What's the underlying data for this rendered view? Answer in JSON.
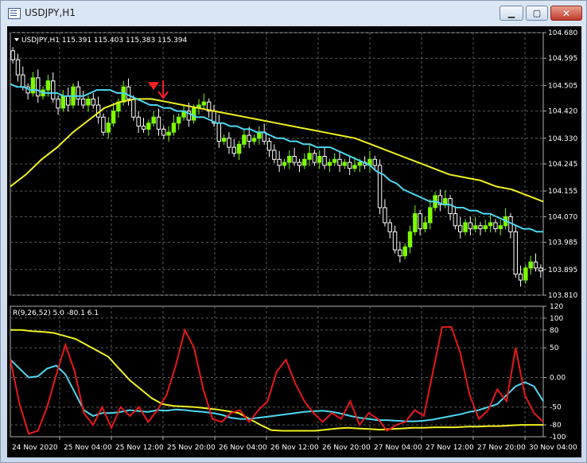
{
  "window": {
    "title": "USDJPY,H1",
    "buttons": {
      "minimize": "▁",
      "maximize": "▢",
      "close": "✕"
    }
  },
  "colors": {
    "background": "#000000",
    "grid": "#5a5a5a",
    "bull_candle": "#7cfc00",
    "bear_candle": "#ffffff",
    "ma_fast": "#4dd8f0",
    "ma_slow": "#f0f020",
    "indicator_line": "#e81818",
    "signal_arrow": "#ff2020",
    "text": "#ffffff"
  },
  "chart_data": [
    {
      "type": "candlestick",
      "header": "USDJPY,H1  115.391 115.403 115.383 115.394",
      "ylim": [
        103.81,
        104.68
      ],
      "y_ticks": [
        "104.680",
        "104.595",
        "104.505",
        "104.420",
        "104.330",
        "104.245",
        "104.155",
        "104.070",
        "103.985",
        "103.895",
        "103.810"
      ],
      "closes": [
        104.59,
        104.54,
        104.5,
        104.48,
        104.53,
        104.47,
        104.49,
        104.52,
        104.46,
        104.43,
        104.47,
        104.44,
        104.5,
        104.46,
        104.44,
        104.46,
        104.44,
        104.4,
        104.35,
        104.38,
        104.42,
        104.45,
        104.5,
        104.46,
        104.4,
        104.37,
        104.36,
        104.38,
        104.4,
        104.36,
        104.34,
        104.35,
        104.38,
        104.4,
        104.42,
        104.39,
        104.43,
        104.44,
        104.45,
        104.42,
        104.38,
        104.32,
        104.33,
        104.3,
        104.28,
        104.31,
        104.34,
        104.32,
        104.33,
        104.35,
        104.32,
        104.29,
        104.26,
        104.24,
        104.25,
        104.27,
        104.25,
        104.24,
        104.26,
        104.28,
        104.25,
        104.27,
        104.24,
        104.25,
        104.26,
        104.24,
        104.25,
        104.23,
        104.24,
        104.25,
        104.24,
        104.26,
        104.24,
        104.1,
        104.05,
        104.02,
        103.96,
        103.94,
        103.97,
        104.02,
        104.08,
        104.03,
        104.05,
        104.1,
        104.14,
        104.11,
        104.13,
        104.08,
        104.04,
        104.02,
        104.05,
        104.03,
        104.04,
        104.03,
        104.04,
        104.05,
        104.03,
        104.04,
        104.07,
        104.02,
        103.88,
        103.86,
        103.9,
        103.92,
        103.9,
        103.89
      ],
      "ma_fast": [
        104.51,
        104.5,
        104.5,
        104.49,
        104.49,
        104.48,
        104.48,
        104.48,
        104.47,
        104.47,
        104.47,
        104.47,
        104.48,
        104.49,
        104.49,
        104.49,
        104.48,
        104.48,
        104.47,
        104.46,
        104.45,
        104.44,
        104.44,
        104.43,
        104.43,
        104.42,
        104.42,
        104.41,
        104.4,
        104.4,
        104.39,
        104.38,
        104.38,
        104.37,
        104.37,
        104.36,
        104.36,
        104.35,
        104.35,
        104.34,
        104.33,
        104.33,
        104.32,
        104.32,
        104.31,
        104.31,
        104.3,
        104.3,
        104.3,
        104.29,
        104.28,
        104.27,
        104.26,
        104.25,
        104.24,
        104.22,
        104.21,
        104.19,
        104.18,
        104.16,
        104.15,
        104.14,
        104.13,
        104.12,
        104.12,
        104.11,
        104.11,
        104.1,
        104.1,
        104.09,
        104.09,
        104.08,
        104.08,
        104.07,
        104.06,
        104.05,
        104.04,
        104.03,
        104.03,
        104.02,
        104.02
      ],
      "ma_slow": [
        104.17,
        104.21,
        104.26,
        104.3,
        104.35,
        104.39,
        104.43,
        104.45,
        104.46,
        104.46,
        104.45,
        104.44,
        104.43,
        104.42,
        104.41,
        104.4,
        104.39,
        104.38,
        104.37,
        104.36,
        104.35,
        104.34,
        104.33,
        104.31,
        104.29,
        104.27,
        104.25,
        104.23,
        104.21,
        104.2,
        104.19,
        104.17,
        104.16,
        104.14,
        104.12
      ],
      "signal_arrow_at_bar": 28
    },
    {
      "type": "line",
      "header": "R(9,26,52) 5.0 -80.1 6.1",
      "ylim": [
        -100,
        120
      ],
      "y_ticks": [
        "120",
        "100",
        "80",
        "50",
        "0.00",
        "-50",
        "-80",
        "-100"
      ],
      "x_tick_labels": [
        "24 Nov 2020",
        "25 Nov 04:00",
        "25 Nov 12:00",
        "25 Nov 20:00",
        "26 Nov 04:00",
        "26 Nov 12:00",
        "26 Nov 20:00",
        "27 Nov 04:00",
        "27 Nov 12:00",
        "27 Nov 20:00",
        "30 Nov 04:00"
      ],
      "series": [
        {
          "color": "#e81818",
          "values": [
            30,
            -45,
            -95,
            -90,
            -50,
            5,
            55,
            10,
            -60,
            -80,
            -50,
            -85,
            -50,
            -65,
            -50,
            -75,
            -55,
            -30,
            20,
            80,
            50,
            -20,
            -70,
            -75,
            -60,
            -55,
            -75,
            -55,
            -40,
            10,
            30,
            -10,
            -40,
            -60,
            -75,
            -60,
            -70,
            -40,
            -80,
            -60,
            -70,
            -90,
            -80,
            -75,
            -55,
            -65,
            10,
            85,
            85,
            40,
            -30,
            -70,
            -55,
            -20,
            -40,
            50,
            -30,
            -60,
            -75
          ]
        },
        {
          "color": "#4dd8f0",
          "values": [
            30,
            15,
            0,
            2,
            15,
            20,
            5,
            -25,
            -55,
            -65,
            -60,
            -60,
            -58,
            -55,
            -57,
            -58,
            -55,
            -56,
            -54,
            -55,
            -57,
            -58,
            -60,
            -63,
            -68,
            -70,
            -70,
            -68,
            -66,
            -64,
            -62,
            -60,
            -58,
            -57,
            -56,
            -58,
            -61,
            -65,
            -68,
            -70,
            -72,
            -72,
            -73,
            -74,
            -74,
            -73,
            -71,
            -68,
            -65,
            -62,
            -58,
            -55,
            -50,
            -45,
            -30,
            -15,
            -8,
            -15,
            -40
          ]
        },
        {
          "color": "#f0f020",
          "values": [
            80,
            80,
            78,
            77,
            75,
            70,
            65,
            55,
            45,
            35,
            15,
            -5,
            -20,
            -35,
            -45,
            -48,
            -49,
            -50,
            -52,
            -54,
            -57,
            -60,
            -70,
            -80,
            -89,
            -90,
            -90,
            -90,
            -90,
            -88,
            -86,
            -85,
            -86,
            -87,
            -88,
            -87,
            -86,
            -85,
            -85,
            -84,
            -84,
            -84,
            -83,
            -83,
            -82,
            -82,
            -81,
            -80,
            -80,
            -80
          ]
        }
      ]
    }
  ]
}
